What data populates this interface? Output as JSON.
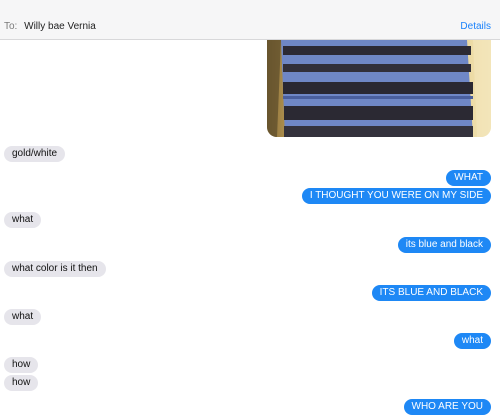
{
  "header": {
    "to_prefix": "To:",
    "recipient": "Willy bae Vernia",
    "details_label": "Details"
  },
  "photo": {
    "subject": "blue and black striped dress photo"
  },
  "messages": [
    {
      "from": "them",
      "text": "gold/white"
    },
    {
      "from": "me",
      "text": "WHAT"
    },
    {
      "from": "me",
      "text": "I THOUGHT YOU WERE ON MY SIDE"
    },
    {
      "from": "them",
      "text": "what"
    },
    {
      "from": "me",
      "text": "its blue and black"
    },
    {
      "from": "them",
      "text": "what color is it then"
    },
    {
      "from": "me",
      "text": "ITS BLUE AND BLACK"
    },
    {
      "from": "them",
      "text": "what"
    },
    {
      "from": "me",
      "text": "what"
    },
    {
      "from": "them",
      "text": "how"
    },
    {
      "from": "them",
      "text": "how"
    },
    {
      "from": "me",
      "text": "WHO ARE YOU"
    }
  ],
  "colors": {
    "outgoing_bubble": "#1e88f5",
    "incoming_bubble": "#e6e5eb",
    "accent": "#1a82fb"
  }
}
